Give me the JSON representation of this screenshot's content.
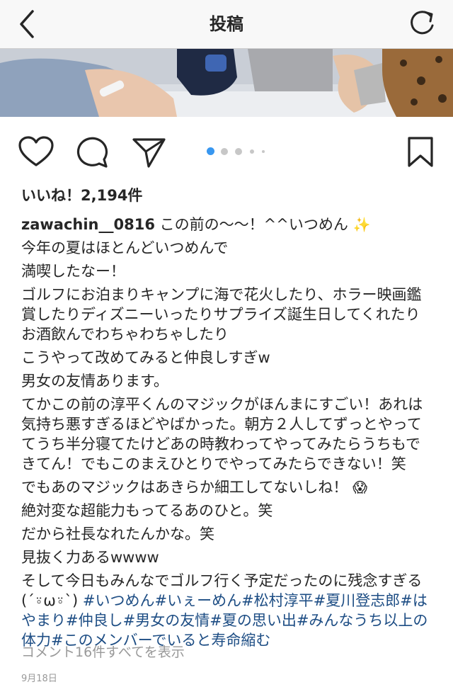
{
  "header": {
    "title": "投稿",
    "back_icon": "chevron-left-icon",
    "refresh_icon": "refresh-icon"
  },
  "carousel": {
    "total": 5,
    "active": 1,
    "active_color": "#3897f0"
  },
  "likes": "いいね！2,194件",
  "caption": {
    "username": "zawachin__0816",
    "first_line": "この前の〜〜！^^いつめん",
    "sparkle": "✨",
    "lines": [
      "今年の夏はほとんどいつめんで",
      "満喫したなー！",
      "ゴルフにお泊まりキャンプに海で花火したり、ホラー映画鑑賞したりディズニーいったりサプライズ誕生日してくれたりお酒飲んでわちゃわちゃしたり",
      "こうやって改めてみると仲良しすぎw",
      "男女の友情あります。",
      "てかこの前の淳平くんのマジックがほんまにすごい！あれは気持ち悪すぎるほどやばかった。朝方２人してずっとやっててうち半分寝てたけどあの時教わってやってみたらうちもできてん！でもこのまえひとりでやってみたらできない！笑"
    ],
    "magic_line": "でもあのマジックはあきらか細工してないしね！",
    "scream": "😱",
    "lines2": [
      "絶対変な超能力もってるあのひと。笑",
      "だから社長なれたんかな。笑",
      "見抜く力あるwwww"
    ],
    "last_text": "そして今日もみんなでゴルフ行く予定だったのに残念すぎる(´⍤ω⍤`) ",
    "hashtags": [
      "#いつめん",
      "#いぇーめん",
      "#松村淳平",
      "#夏川登志郎",
      "#はやまり",
      "#仲良し",
      "#男女の友情",
      "#夏の思い出",
      "#みんなうち以上の体力",
      "#このメンバーでいると寿命縮む"
    ]
  },
  "comments_link": "コメント16件すべてを表示",
  "date": "9月18日",
  "colors": {
    "hashtag": "#1d4d84",
    "muted": "#999999",
    "nav_bg": "#f8f8f8"
  }
}
